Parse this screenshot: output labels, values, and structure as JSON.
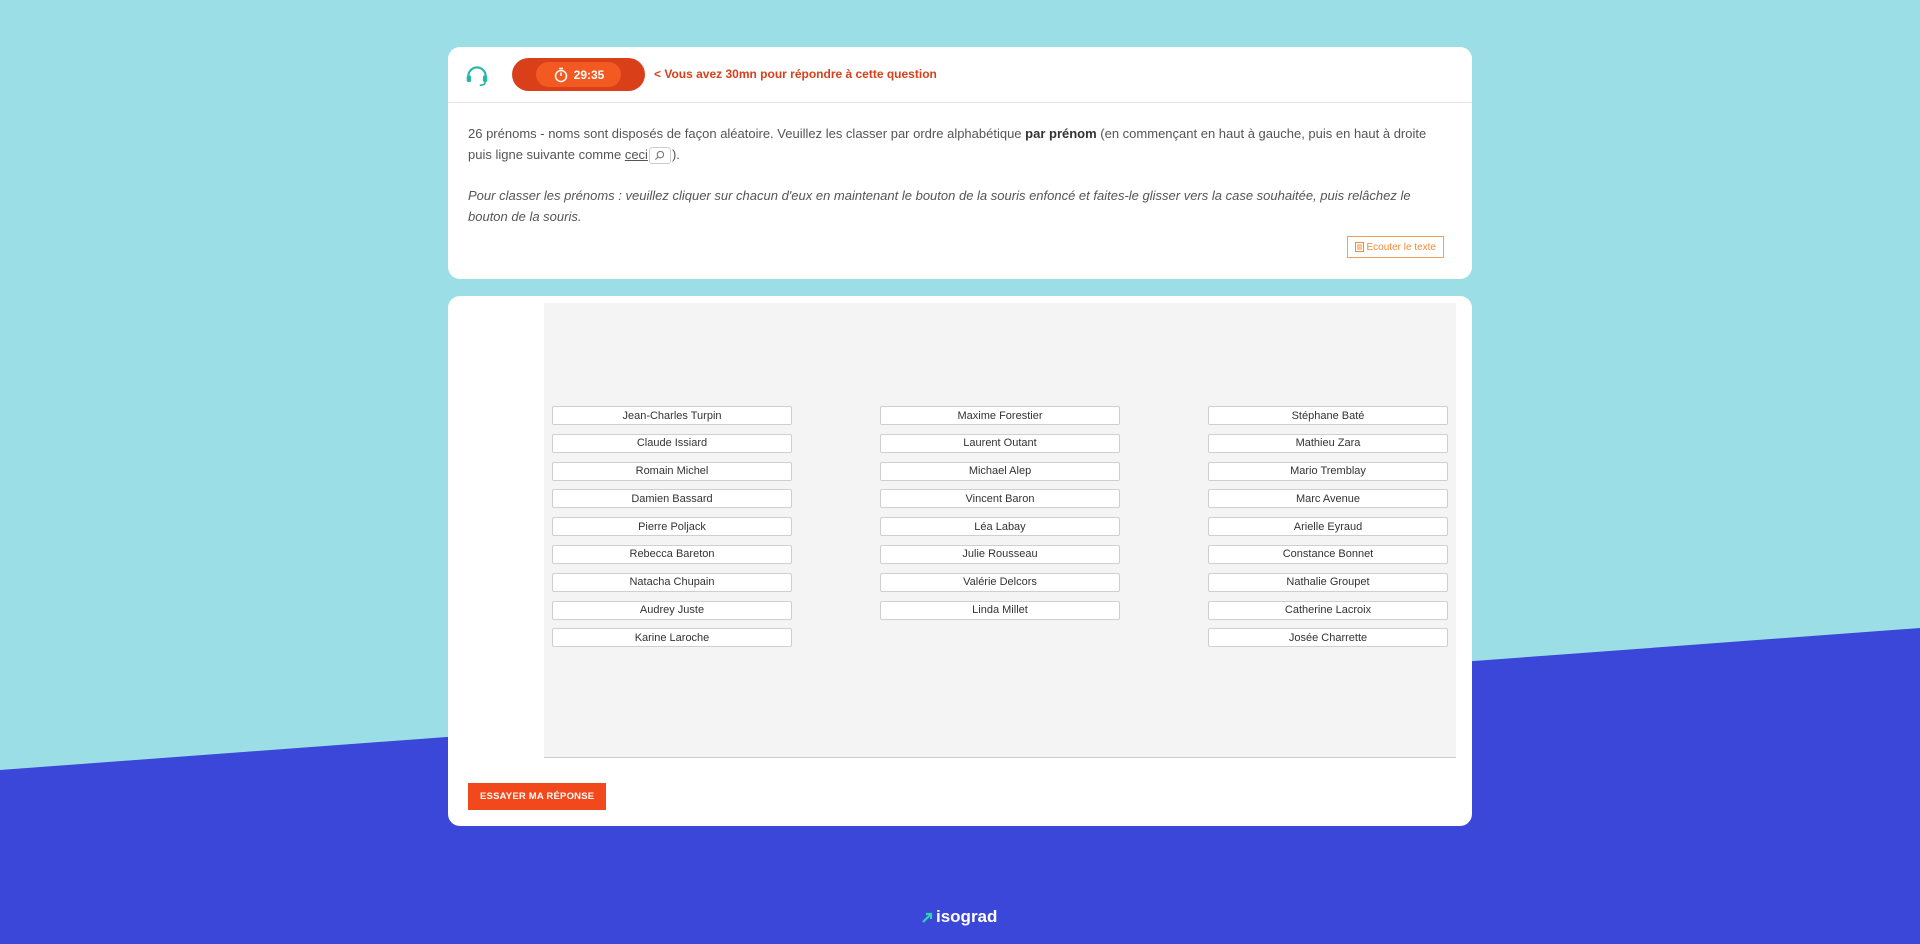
{
  "header": {
    "timer": "29:35",
    "timer_note": "< Vous avez 30mn pour répondre à cette question"
  },
  "question": {
    "part1": "26 prénoms - noms sont disposés de façon aléatoire. Veuillez les classer par ordre alphabétique ",
    "bold": "par prénom",
    "part2": " (en commençant en haut à gauche, puis en haut à droite puis ligne suivante comme ",
    "link": "ceci",
    "part3": ").",
    "instructions": "Pour classer les prénoms : veuillez cliquer sur chacun d'eux en maintenant le bouton de la souris enfoncé et faites-le glisser vers la case souhaitée, puis relâchez le bouton de la souris.",
    "listen_label": "Ecouter le texte"
  },
  "names": {
    "col0": [
      "Jean-Charles Turpin",
      "Claude Issiard",
      "Romain Michel",
      "Damien Bassard",
      "Pierre Poljack",
      "Rebecca Bareton",
      "Natacha Chupain",
      "Audrey Juste",
      "Karine Laroche"
    ],
    "col1": [
      "Maxime Forestier",
      "Laurent Outant",
      "Michael Alep",
      "Vincent Baron",
      "Léa Labay",
      "Julie Rousseau",
      "Valérie Delcors",
      "Linda Millet"
    ],
    "col2": [
      "Stéphane Baté",
      "Mathieu Zara",
      "Mario Tremblay",
      "Marc Avenue",
      "Arielle Eyraud",
      "Constance Bonnet",
      "Nathalie Groupet",
      "Catherine Lacroix",
      "Josée Charrette"
    ]
  },
  "submit_label": "ESSAYER MA RÉPONSE",
  "footer": {
    "brand": "isograd"
  },
  "colors": {
    "teal_bg": "#9cdee6",
    "blue_bg": "#3a47d8",
    "accent": "#f1481c",
    "timer_dark": "#d9401a"
  }
}
